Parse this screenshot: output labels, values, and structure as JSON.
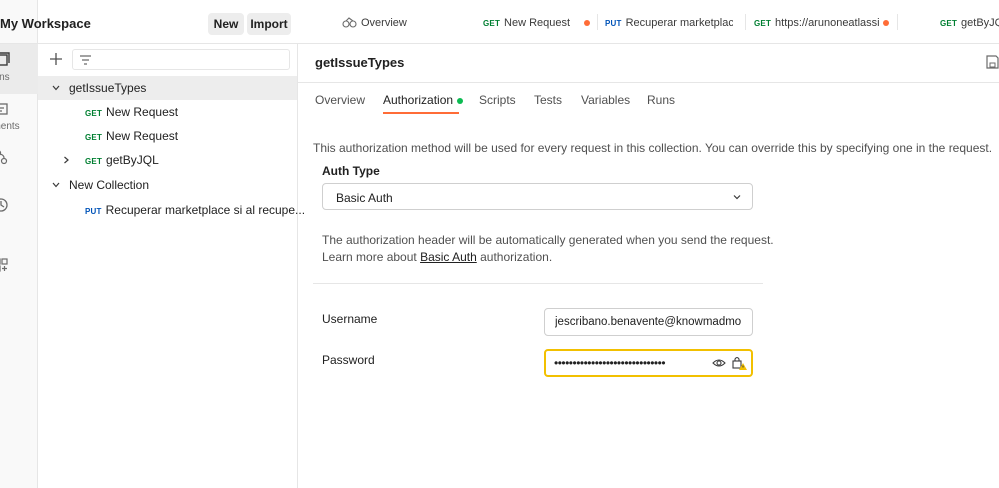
{
  "workspace": {
    "title": "My Workspace",
    "new_label": "New",
    "import_label": "Import"
  },
  "rail": {
    "items": [
      {
        "label": "ections",
        "icon": "collections-icon",
        "active": true
      },
      {
        "label": "ronments",
        "icon": "environments-icon",
        "active": false
      },
      {
        "label": "ows",
        "icon": "flows-icon",
        "active": false
      },
      {
        "label": "tory",
        "icon": "history-icon",
        "active": false
      },
      {
        "label": "",
        "icon": "apps-icon",
        "active": false
      }
    ]
  },
  "sidebar": {
    "tree": [
      {
        "label": "getIssueTypes",
        "type": "collection",
        "expanded": true,
        "selected": true
      },
      {
        "method": "GET",
        "label": "New Request",
        "type": "request"
      },
      {
        "method": "GET",
        "label": "New Request",
        "type": "request"
      },
      {
        "method": "GET",
        "label": "getByJQL",
        "type": "folder",
        "expanded": false
      },
      {
        "label": "New Collection",
        "type": "collection",
        "expanded": true
      },
      {
        "method": "PUT",
        "label": "Recuperar marketplace si al recupe...",
        "type": "request"
      }
    ]
  },
  "tabs": [
    {
      "label": "Overview",
      "icon": "overview-icon"
    },
    {
      "method": "GET",
      "label": "New Request",
      "unsaved": true
    },
    {
      "method": "PUT",
      "label": "Recuperar marketplace :"
    },
    {
      "method": "GET",
      "label": "https://arunoneatlassia",
      "unsaved": true
    },
    {
      "method": "GET",
      "label": "getByJQL"
    }
  ],
  "main": {
    "title": "getIssueTypes",
    "subtabs": [
      "Overview",
      "Authorization",
      "Scripts",
      "Tests",
      "Variables",
      "Runs"
    ],
    "active_subtab": "Authorization",
    "description": "This authorization method will be used for every request in this collection. You can override this by specifying one in the request.",
    "auth_type_label": "Auth Type",
    "auth_type_value": "Basic Auth",
    "info_line1": "The authorization header will be automatically generated when you send the request.",
    "info_line2_prefix": "Learn more about ",
    "info_line2_link": "Basic Auth",
    "info_line2_suffix": " authorization.",
    "username_label": "Username",
    "username_value": "jescribano.benavente@knowmadmo",
    "password_label": "Password",
    "password_mask": "••••••••••••••••••••••••••••••"
  },
  "colors": {
    "accent": "#ff6c37",
    "get": "#007f31",
    "put": "#0053b8",
    "focus": "#f2c000",
    "active_dot": "#0cbb52"
  }
}
